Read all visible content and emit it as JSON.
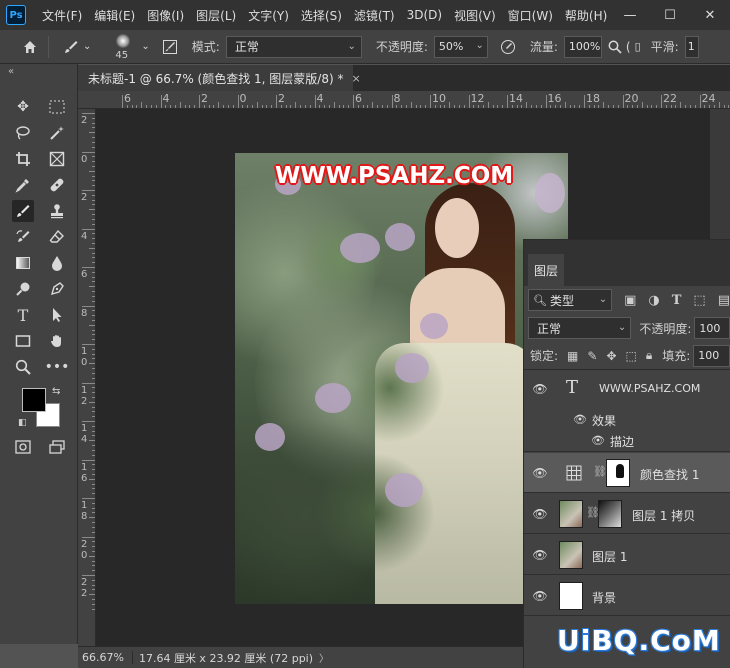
{
  "app": {
    "logo": "Ps",
    "menu": [
      "文件(F)",
      "编辑(E)",
      "图像(I)",
      "图层(L)",
      "文字(Y)",
      "选择(S)",
      "滤镜(T)",
      "3D(D)",
      "视图(V)",
      "窗口(W)",
      "帮助(H)"
    ],
    "window_controls": [
      "—",
      "☐",
      "✕"
    ]
  },
  "options_bar": {
    "brush_size": "45",
    "mode_label": "模式:",
    "mode_value": "正常",
    "opacity_label": "不透明度:",
    "opacity_value": "50%",
    "flow_label": "流量:",
    "flow_value": "100%",
    "smooth_label": "平滑:",
    "smooth_value": "1"
  },
  "document": {
    "tab_title": "未标题-1 @ 66.7% (颜色查找 1, 图层蒙版/8) *",
    "close_glyph": "×",
    "watermark": "WWW.PSAHZ.COM"
  },
  "rulers": {
    "top": [
      "6",
      "4",
      "2",
      "0",
      "2",
      "4",
      "6",
      "8",
      "10",
      "12",
      "14",
      "16",
      "18",
      "20",
      "22",
      "24"
    ],
    "left": [
      "2",
      "0",
      "2",
      "4",
      "6",
      "8",
      "1\n0",
      "1\n2",
      "1\n4",
      "1\n6",
      "1\n8",
      "2\n0",
      "2\n2"
    ]
  },
  "status": {
    "zoom": "66.67%",
    "doc_size": "17.64 厘米 x 23.92 厘米 (72 ppi)",
    "arrow": "〉"
  },
  "layers_panel": {
    "tab": "图层",
    "filter_value": "类型",
    "blend_value": "正常",
    "opacity_label": "不透明度:",
    "opacity_value": "100",
    "lock_label": "锁定:",
    "fill_label": "填充:",
    "fill_value": "100",
    "layers": [
      {
        "name": "WWW.PSAHZ.COM",
        "kind": "text"
      },
      {
        "name": "效果",
        "kind": "effects"
      },
      {
        "name": "描边",
        "kind": "effect-item"
      },
      {
        "name": "颜色查找 1",
        "kind": "adjustment",
        "selected": true
      },
      {
        "name": "图层 1 拷贝",
        "kind": "pixel-masked"
      },
      {
        "name": "图层 1",
        "kind": "pixel"
      },
      {
        "name": "背景",
        "kind": "background"
      }
    ],
    "text_layer_glyph": "T"
  },
  "bottom_watermark": "UiBQ.CoM",
  "colors": {
    "foreground": "#000000",
    "background": "#ffffff",
    "accent": "#31a8ff"
  }
}
